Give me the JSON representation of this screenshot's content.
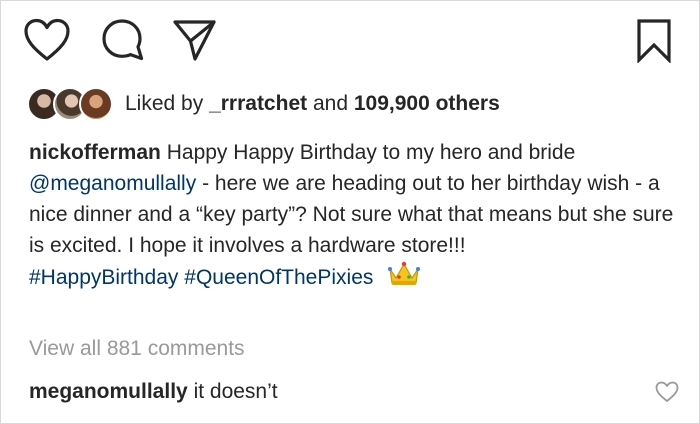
{
  "actions": {
    "like_icon": "heart-icon",
    "comment_icon": "speech-bubble-icon",
    "share_icon": "paper-plane-icon",
    "save_icon": "bookmark-icon"
  },
  "likes": {
    "prefix": "Liked by",
    "first_user": "_rrratchet",
    "connector": "and",
    "others": "109,900 others"
  },
  "caption": {
    "username": "nickofferman",
    "text_1": "Happy Happy Birthday to my hero and bride",
    "mention": "@meganomullally",
    "text_2": "- here we are heading out to her birthday wish - a nice dinner and a “key party”? Not sure what that means but she sure is excited. I hope it involves a hardware store!!!",
    "hashtag_1": "#HappyBirthday",
    "hashtag_2": "#QueenOfThePixies",
    "emoji": "crown-emoji"
  },
  "view_comments": "View all 881 comments",
  "comment": {
    "username": "meganomullally",
    "text": "it doesn’t",
    "like_icon": "heart-outline-icon"
  },
  "colors": {
    "text": "#262626",
    "link": "#003569",
    "muted": "#999999",
    "border": "#d9d9d9"
  }
}
